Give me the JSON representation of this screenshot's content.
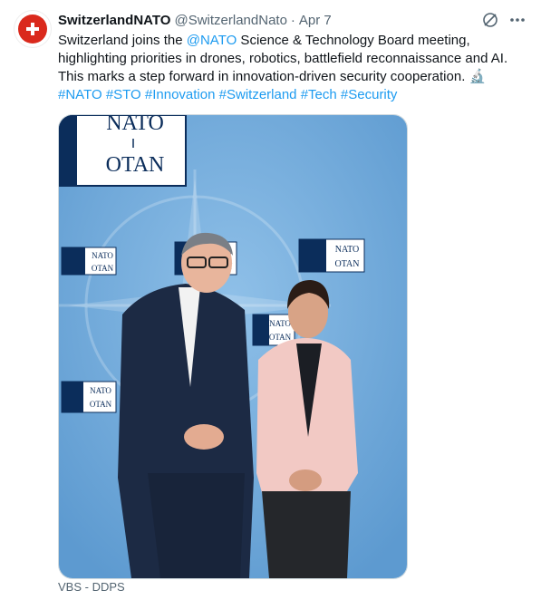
{
  "author": {
    "display_name": "SwitzerlandNATO",
    "handle": "@SwitzerlandNato",
    "separator": "·",
    "date": "Apr 7"
  },
  "tweet": {
    "text_1": "Switzerland joins the ",
    "mention": "@NATO",
    "text_2": " Science & Technology Board meeting, highlighting priorities in drones, robotics, battlefield reconnaissance and AI. This marks a step forward in innovation-driven security cooperation. ",
    "emoji": "🔬",
    "hashtags": [
      "#NATO",
      "#STO",
      "#Innovation",
      "#Switzerland",
      "#Tech",
      "#Security"
    ]
  },
  "media": {
    "logo_top": "NATO",
    "logo_bottom": "OTAN",
    "caption": "VBS - DDPS"
  },
  "icons": {
    "avatar": "swiss-cross-icon",
    "grok": "grok-icon",
    "more": "more-icon"
  },
  "colors": {
    "link": "#1d9bf0",
    "swiss_red": "#da291c",
    "backdrop": "#6aa6d9",
    "nato_navy": "#0b2d5b"
  }
}
